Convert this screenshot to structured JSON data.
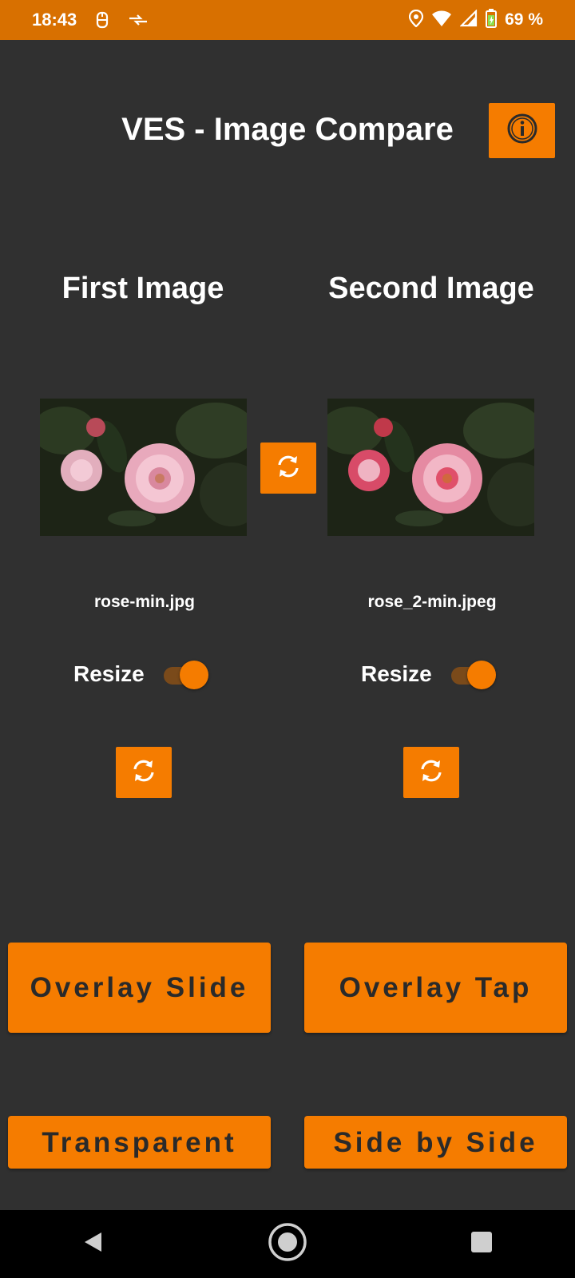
{
  "status": {
    "time": "18:43",
    "battery": "69 %"
  },
  "app": {
    "title": "VES - Image Compare"
  },
  "first": {
    "heading": "First Image",
    "filename": "rose-min.jpg",
    "resize_label": "Resize",
    "resize_on": true
  },
  "second": {
    "heading": "Second Image",
    "filename": "rose_2-min.jpeg",
    "resize_label": "Resize",
    "resize_on": true
  },
  "buttons": {
    "overlay_slide": "Overlay Slide",
    "overlay_tap": "Overlay Tap",
    "transparent": "Transparent",
    "side_by_side": "Side by Side"
  },
  "colors": {
    "accent": "#f57c00",
    "status_bar": "#d87000",
    "background": "#303030"
  }
}
